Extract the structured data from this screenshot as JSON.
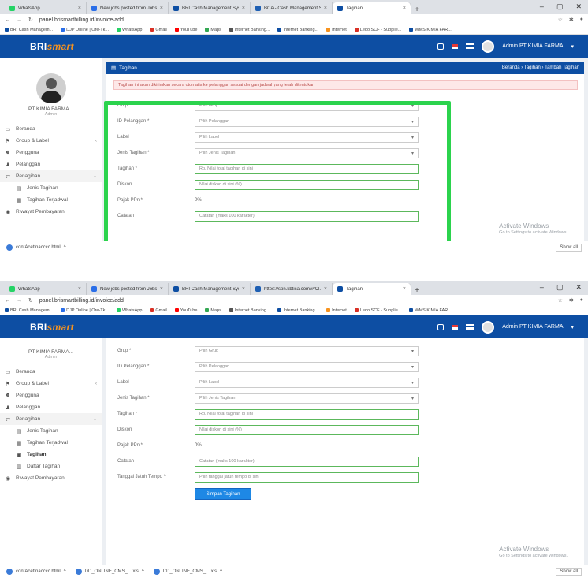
{
  "colors": {
    "brand_blue": "#0d4ea3",
    "accent_orange": "#f7931e",
    "highlight_green": "#2bd34d",
    "save_blue": "#1e88e5"
  },
  "shot1": {
    "tabs": [
      {
        "label": "WhatsApp",
        "active": false
      },
      {
        "label": "New jobs posted from Jobs...",
        "active": false
      },
      {
        "label": "BRI Cash Management Syst...",
        "active": false
      },
      {
        "label": "BCA - Cash Management S...",
        "active": false
      },
      {
        "label": "Tagihan",
        "active": true
      }
    ],
    "url": "panel.brismartbilling.id/invoice/add",
    "bookmarks": [
      "BRI Cash Managem...",
      "DJP Online | Ore-Tk...",
      "WhatsApp",
      "Gmail",
      "YouTube",
      "Maps",
      "Internet Banking...",
      "Internet Banking...",
      "Internet",
      "Ledo SCF - Supplie...",
      "WMS KIMIA FAR..."
    ],
    "app": {
      "user": "Admin PT KIMIA FARMA"
    },
    "profile": {
      "name": "PT KIMIA FARMA...",
      "role": "Admin"
    },
    "nav": [
      {
        "icon": "▭",
        "label": "Beranda",
        "caret": "",
        "cls": ""
      },
      {
        "icon": "⚑",
        "label": "Group & Label",
        "caret": "‹",
        "cls": ""
      },
      {
        "icon": "☻",
        "label": "Pengguna",
        "caret": "",
        "cls": ""
      },
      {
        "icon": "♟",
        "label": "Pelanggan",
        "caret": "",
        "cls": ""
      },
      {
        "icon": "⇄",
        "label": "Penagihan",
        "caret": "⌄",
        "cls": "open"
      },
      {
        "icon": "▤",
        "label": "Jenis Tagihan",
        "caret": "",
        "cls": "sub"
      },
      {
        "icon": "▦",
        "label": "Tagihan Terjadwal",
        "caret": "",
        "cls": "sub"
      },
      {
        "icon": "◉",
        "label": "Riwayat Pembayaran",
        "caret": "",
        "cls": ""
      }
    ],
    "panel": {
      "title": "Tagihan",
      "breadcrumb": "Beranda › Tagihan › Tambah Tagihan",
      "alert": "Tagihan ini akan dikirimkan secara otomatis ke pelanggan sesuai dengan jadwal yang telah ditentukan"
    },
    "form": [
      {
        "label": "Grup *",
        "value": "Pilih Grup",
        "kind": "select"
      },
      {
        "label": "ID Pelanggan *",
        "value": "Pilih Pelanggan",
        "kind": "select"
      },
      {
        "label": "Label",
        "value": "Pilih Label",
        "kind": "select"
      },
      {
        "label": "Jenis Tagihan *",
        "value": "Pilih Jenis Tagihan",
        "kind": "select"
      },
      {
        "label": "Tagihan *",
        "value": "Rp. Nilai total tagihan di sini",
        "kind": "input"
      },
      {
        "label": "Diskon",
        "value": "Nilai diskon di sini (%)",
        "kind": "input"
      },
      {
        "label": "Pajak PPn *",
        "value": "0%",
        "kind": "plain"
      },
      {
        "label": "Catatan",
        "value": "Catatan (maks 100 karakter)",
        "kind": "input"
      }
    ],
    "activate": {
      "title": "Activate Windows",
      "sub": "Go to Settings to activate Windows."
    },
    "downloads": [
      {
        "label": "contAcetfnacccc.html"
      }
    ],
    "show_all": "Show all"
  },
  "shot2": {
    "tabs": [
      {
        "label": "WhatsApp",
        "active": false
      },
      {
        "label": "New jobs posted from Jobs...",
        "active": false
      },
      {
        "label": "BRI Cash Management Syst...",
        "active": false
      },
      {
        "label": "https://spn.kbtica.com/#/Cl...",
        "active": false
      },
      {
        "label": "Tagihan",
        "active": true
      }
    ],
    "url": "panel.brismartbilling.id/invoice/add",
    "bookmarks": [
      "BRI Cash Managem...",
      "DJP Online | Ore-Tk...",
      "WhatsApp",
      "Gmail",
      "YouTube",
      "Maps",
      "Internet Banking...",
      "Internet Banking...",
      "Internet",
      "Ledo SCF - Supplie...",
      "WMS KIMIA FAR..."
    ],
    "app": {
      "user": "Admin PT KIMIA FARMA"
    },
    "profile": {
      "name": "PT KIMIA FARMA...",
      "role": "Admin"
    },
    "nav": [
      {
        "icon": "▭",
        "label": "Beranda",
        "caret": "",
        "cls": ""
      },
      {
        "icon": "⚑",
        "label": "Group & Label",
        "caret": "‹",
        "cls": ""
      },
      {
        "icon": "☻",
        "label": "Pengguna",
        "caret": "",
        "cls": ""
      },
      {
        "icon": "♟",
        "label": "Pelanggan",
        "caret": "",
        "cls": ""
      },
      {
        "icon": "⇄",
        "label": "Penagihan",
        "caret": "⌄",
        "cls": "open"
      },
      {
        "icon": "▤",
        "label": "Jenis Tagihan",
        "caret": "",
        "cls": "sub"
      },
      {
        "icon": "▦",
        "label": "Tagihan Terjadwal",
        "caret": "",
        "cls": "sub"
      },
      {
        "icon": "▣",
        "label": "Tagihan",
        "caret": "",
        "cls": "sub active"
      },
      {
        "icon": "▥",
        "label": "Daftar Tagihan",
        "caret": "",
        "cls": "sub"
      },
      {
        "icon": "◉",
        "label": "Riwayat Pembayaran",
        "caret": "",
        "cls": ""
      }
    ],
    "form": [
      {
        "label": "Grup *",
        "value": "Pilih Grup",
        "kind": "select"
      },
      {
        "label": "ID Pelanggan *",
        "value": "Pilih Pelanggan",
        "kind": "select"
      },
      {
        "label": "Label",
        "value": "Pilih Label",
        "kind": "select"
      },
      {
        "label": "Jenis Tagihan *",
        "value": "Pilih Jenis Tagihan",
        "kind": "select"
      },
      {
        "label": "Tagihan *",
        "value": "Rp. Nilai total tagihan di sini",
        "kind": "input"
      },
      {
        "label": "Diskon",
        "value": "Nilai diskon di sini (%)",
        "kind": "input"
      },
      {
        "label": "Pajak PPn *",
        "value": "0%",
        "kind": "plain"
      },
      {
        "label": "Catatan",
        "value": "Catatan (maks 100 karakter)",
        "kind": "input"
      },
      {
        "label": "Tanggal Jatuh Tempo *",
        "value": "Pilih tanggal jatuh tempo di sini",
        "kind": "input"
      }
    ],
    "save_label": "Simpan Tagihan",
    "activate": {
      "title": "Activate Windows",
      "sub": "Go to Settings to activate Windows."
    },
    "downloads": [
      {
        "label": "contAcetfnacccc.html"
      },
      {
        "label": "DD_ONLINE_CMS_....xls"
      },
      {
        "label": "DD_ONLINE_CMS_....xls"
      }
    ],
    "show_all": "Show all"
  }
}
